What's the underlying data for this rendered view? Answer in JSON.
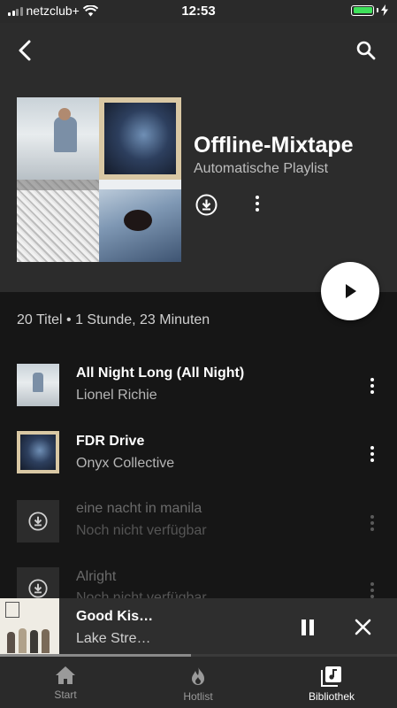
{
  "status": {
    "carrier": "netzclub+",
    "time": "12:53"
  },
  "header": {
    "back_icon": "back-arrow-icon",
    "search_icon": "search-icon",
    "title": "Offline-Mixtape",
    "subtitle": "Automatische Playlist"
  },
  "summary": "20 Titel • 1 Stunde, 23 Minuten",
  "tracks": [
    {
      "title": "All Night Long (All Night)",
      "artist": "Lionel Richie",
      "available": true
    },
    {
      "title": "FDR Drive",
      "artist": "Onyx Collective",
      "available": true
    },
    {
      "title": "eine nacht in manila",
      "artist": "Noch nicht verfügbar",
      "available": false
    },
    {
      "title": "Alright",
      "artist": "Noch nicht verfügbar",
      "available": false
    }
  ],
  "now_playing": {
    "title": "Good Kis…",
    "artist": "Lake Stre…",
    "progress": 0.48
  },
  "tabs": [
    {
      "label": "Start",
      "icon": "home-icon",
      "active": false
    },
    {
      "label": "Hotlist",
      "icon": "flame-icon",
      "active": false
    },
    {
      "label": "Bibliothek",
      "icon": "library-icon",
      "active": true
    }
  ],
  "colors": {
    "battery": "#3ee05a",
    "header_bg": "#2c2c2c",
    "list_bg": "#161616"
  }
}
